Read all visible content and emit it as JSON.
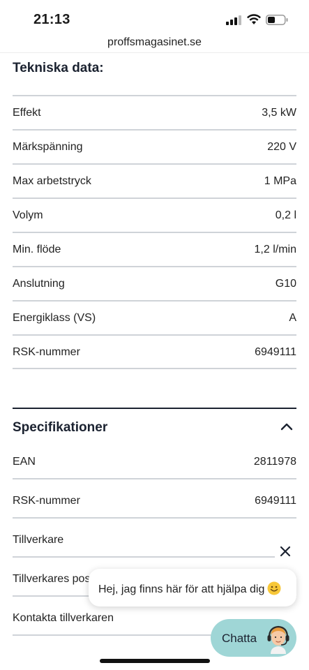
{
  "status_bar": {
    "time": "21:13"
  },
  "browser": {
    "url": "proffsmagasinet.se"
  },
  "technical": {
    "title": "Tekniska data:",
    "rows": [
      {
        "label": "Effekt",
        "value": "3,5 kW"
      },
      {
        "label": "Märkspänning",
        "value": "220 V"
      },
      {
        "label": "Max arbetstryck",
        "value": "1 MPa"
      },
      {
        "label": "Volym",
        "value": "0,2 l"
      },
      {
        "label": "Min. flöde",
        "value": "1,2 l/min"
      },
      {
        "label": "Anslutning",
        "value": "G10"
      },
      {
        "label": "Energiklass (VS)",
        "value": "A"
      },
      {
        "label": "RSK-nummer",
        "value": "6949111"
      }
    ]
  },
  "specifications": {
    "title": "Specifikationer",
    "expanded": true,
    "rows": [
      {
        "label": "EAN",
        "value": "2811978"
      },
      {
        "label": "RSK-nummer",
        "value": "6949111"
      },
      {
        "label": "Tillverkare",
        "value": ""
      },
      {
        "label": "Tillverkares pos",
        "value": ""
      },
      {
        "label": "Kontakta tillverkaren",
        "value": ""
      }
    ]
  },
  "chat": {
    "message": "Hej, jag finns här för att hjälpa dig",
    "button_label": "Chatta"
  },
  "icons": {
    "close": "close-icon",
    "chevron": "chevron-up-icon",
    "smiley": "smiley-icon",
    "agent": "support-agent-icon"
  },
  "colors": {
    "chat_button": "#9fd6d6",
    "heading": "#1b2230",
    "divider": "#cfd3d8"
  }
}
